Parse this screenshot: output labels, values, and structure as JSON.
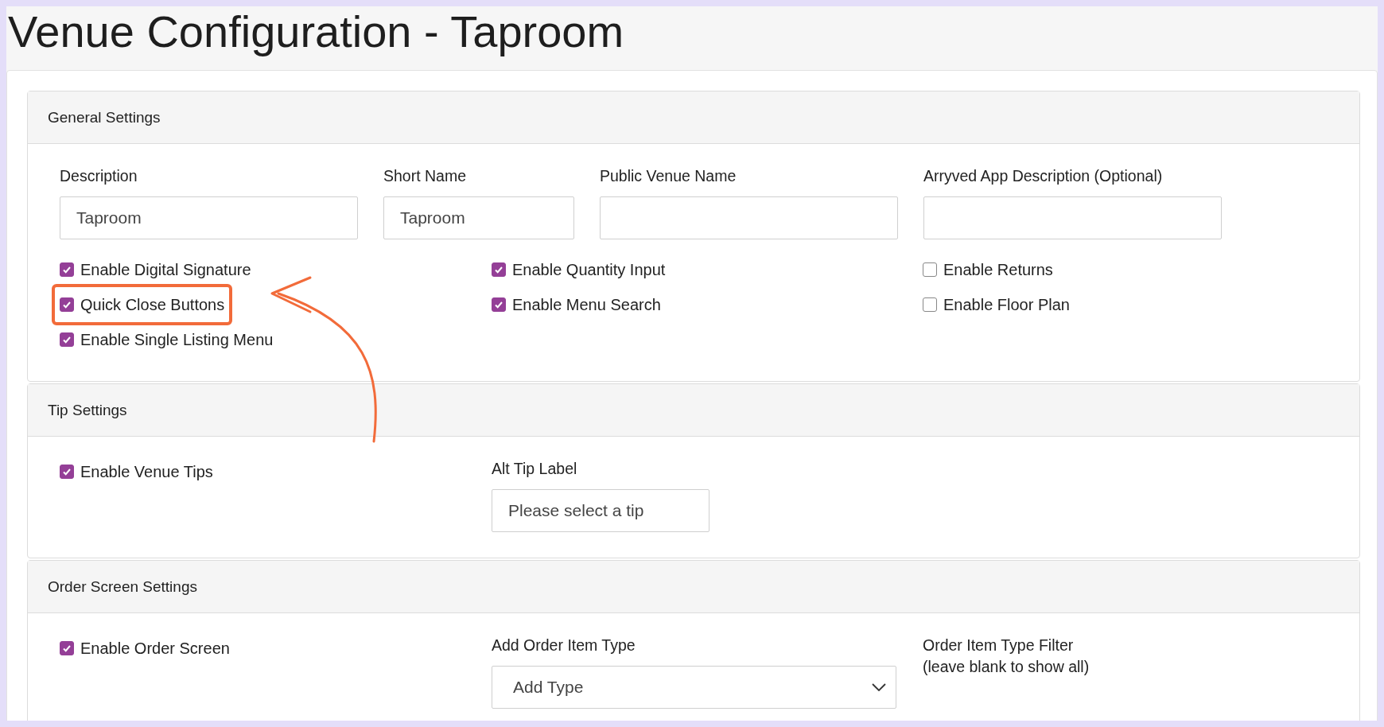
{
  "title": "Venue Configuration - Taproom",
  "sections": [
    {
      "kind": "general",
      "title": "General Settings",
      "fields": [
        {
          "label": "Description",
          "value": "Taproom"
        },
        {
          "label": "Short Name",
          "value": "Taproom"
        },
        {
          "label": "Public Venue Name"
        },
        {
          "label": "Arryved App Description (Optional)"
        }
      ],
      "checkbox_columns": [
        [
          {
            "label": "Enable Digital Signature",
            "checked": true,
            "highlighted": false
          },
          {
            "label": "Quick Close Buttons",
            "checked": true,
            "highlighted": true
          },
          {
            "label": "Enable Single Listing Menu",
            "checked": true,
            "highlighted": false
          }
        ],
        [
          {
            "label": "Enable Quantity Input",
            "checked": true,
            "highlighted": false
          },
          {
            "label": "Enable Menu Search",
            "checked": true,
            "highlighted": false
          }
        ],
        [
          {
            "label": "Enable Returns",
            "checked": false,
            "highlighted": false
          },
          {
            "label": "Enable Floor Plan",
            "checked": false,
            "highlighted": false
          }
        ]
      ]
    },
    {
      "kind": "tip",
      "title": "Tip Settings",
      "checkbox": {
        "label": "Enable Venue Tips",
        "checked": true
      },
      "field": {
        "label": "Alt Tip Label",
        "placeholder": "Please select a tip"
      }
    },
    {
      "kind": "order",
      "title": "Order Screen Settings",
      "checkbox": {
        "label": "Enable Order Screen",
        "checked": true
      },
      "select": {
        "label": "Add Order Item Type",
        "value": "Add Type"
      },
      "filter": {
        "label": "Order Item Type Filter",
        "hint": "(leave blank to show all)"
      }
    }
  ]
}
